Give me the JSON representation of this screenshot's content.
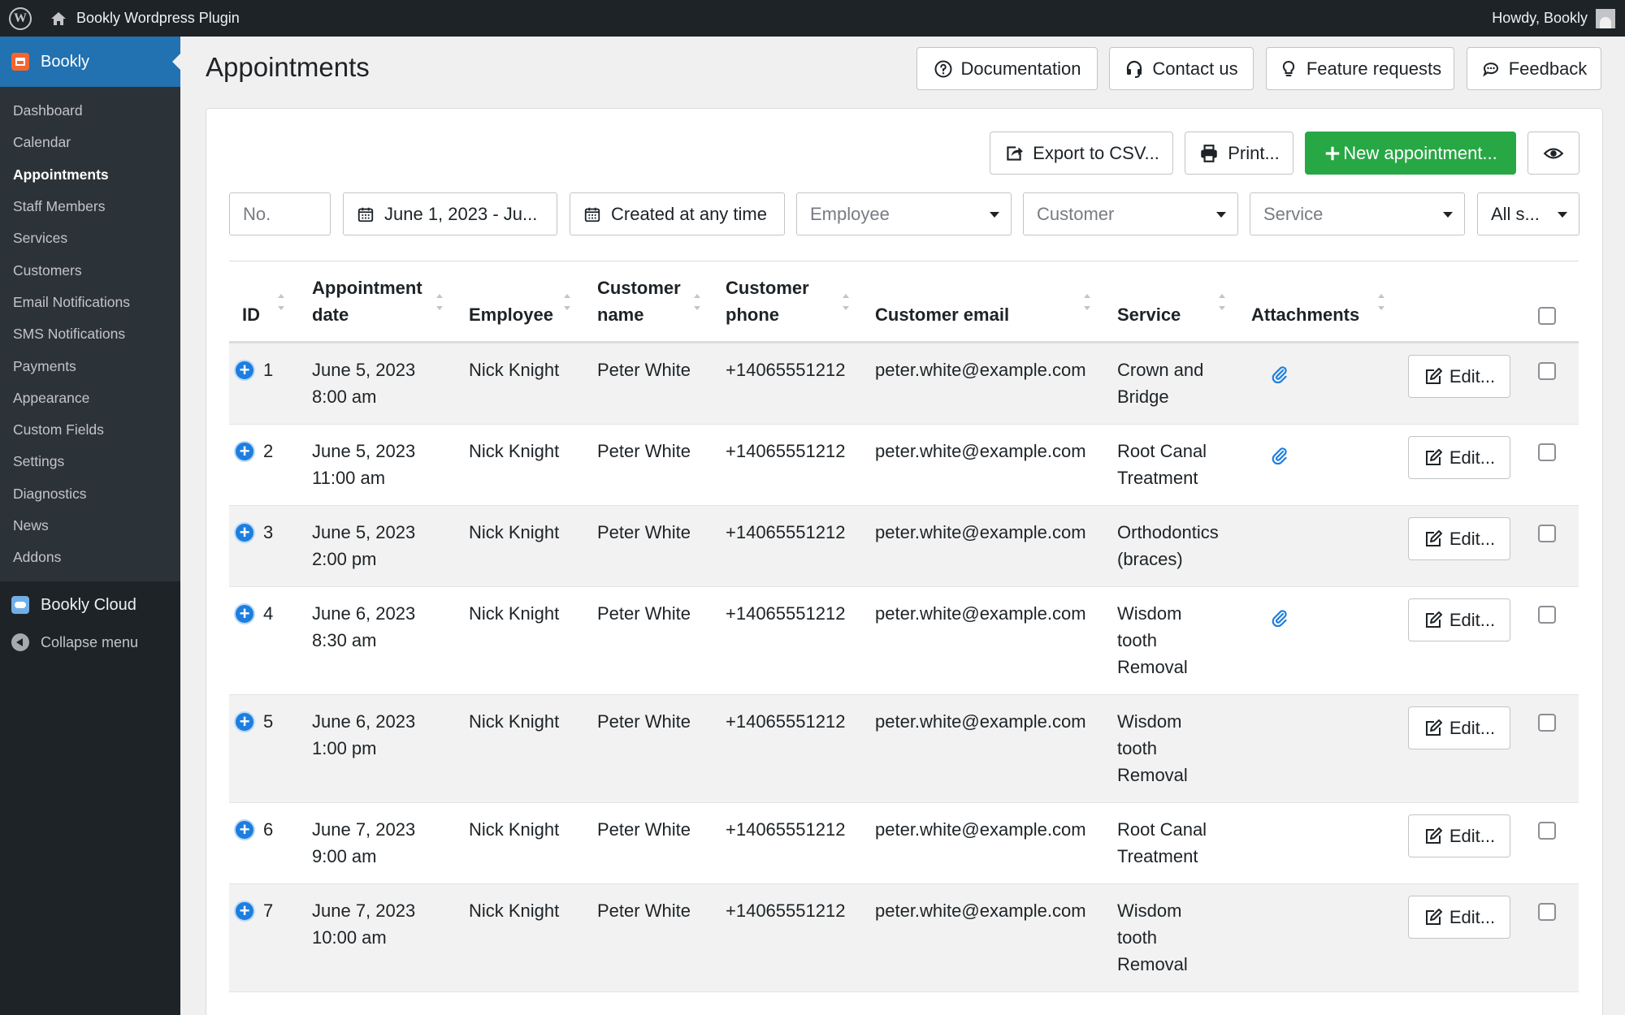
{
  "admin_bar": {
    "site_name": "Bookly Wordpress Plugin",
    "greeting": "Howdy, Bookly"
  },
  "sidebar": {
    "plugin": "Bookly",
    "items": [
      {
        "label": "Dashboard"
      },
      {
        "label": "Calendar"
      },
      {
        "label": "Appointments",
        "active": true
      },
      {
        "label": "Staff Members"
      },
      {
        "label": "Services"
      },
      {
        "label": "Customers"
      },
      {
        "label": "Email Notifications"
      },
      {
        "label": "SMS Notifications"
      },
      {
        "label": "Payments"
      },
      {
        "label": "Appearance"
      },
      {
        "label": "Custom Fields"
      },
      {
        "label": "Settings"
      },
      {
        "label": "Diagnostics"
      },
      {
        "label": "News"
      },
      {
        "label": "Addons"
      }
    ],
    "cloud": "Bookly Cloud",
    "collapse": "Collapse menu"
  },
  "page": {
    "title": "Appointments",
    "header_buttons": {
      "documentation": "Documentation",
      "contact": "Contact us",
      "feature_requests": "Feature requests",
      "feedback": "Feedback"
    }
  },
  "toolbar": {
    "export": "Export to CSV...",
    "print": "Print...",
    "new_appointment": "New appointment..."
  },
  "filters": {
    "number_placeholder": "No.",
    "date_range": "June 1, 2023 - Ju...",
    "created": "Created at any time",
    "employee": "Employee",
    "customer": "Customer",
    "service": "Service",
    "status": "All s..."
  },
  "table": {
    "columns": {
      "id": "ID",
      "date_1": "Appointment",
      "date_2": "date",
      "employee": "Employee",
      "name_1": "Customer",
      "name_2": "name",
      "phone_1": "Customer",
      "phone_2": "phone",
      "email": "Customer email",
      "service": "Service",
      "attachments": "Attachments"
    },
    "edit_label": "Edit...",
    "rows": [
      {
        "id": "1",
        "date": "June 5, 2023",
        "time": "8:00 am",
        "employee": "Nick Knight",
        "customer": "Peter White",
        "phone": "+14065551212",
        "email": "peter.white@example.com",
        "service": [
          "Crown and",
          "Bridge"
        ],
        "attachment": true
      },
      {
        "id": "2",
        "date": "June 5, 2023",
        "time": "11:00 am",
        "employee": "Nick Knight",
        "customer": "Peter White",
        "phone": "+14065551212",
        "email": "peter.white@example.com",
        "service": [
          "Root Canal",
          "Treatment"
        ],
        "attachment": true
      },
      {
        "id": "3",
        "date": "June 5, 2023",
        "time": "2:00 pm",
        "employee": "Nick Knight",
        "customer": "Peter White",
        "phone": "+14065551212",
        "email": "peter.white@example.com",
        "service": [
          "Orthodontics",
          "(braces)"
        ],
        "attachment": false
      },
      {
        "id": "4",
        "date": "June 6, 2023",
        "time": "8:30 am",
        "employee": "Nick Knight",
        "customer": "Peter White",
        "phone": "+14065551212",
        "email": "peter.white@example.com",
        "service": [
          "Wisdom",
          "tooth",
          "Removal"
        ],
        "attachment": true
      },
      {
        "id": "5",
        "date": "June 6, 2023",
        "time": "1:00 pm",
        "employee": "Nick Knight",
        "customer": "Peter White",
        "phone": "+14065551212",
        "email": "peter.white@example.com",
        "service": [
          "Wisdom",
          "tooth",
          "Removal"
        ],
        "attachment": false
      },
      {
        "id": "6",
        "date": "June 7, 2023",
        "time": "9:00 am",
        "employee": "Nick Knight",
        "customer": "Peter White",
        "phone": "+14065551212",
        "email": "peter.white@example.com",
        "service": [
          "Root Canal",
          "Treatment"
        ],
        "attachment": false
      },
      {
        "id": "7",
        "date": "June 7, 2023",
        "time": "10:00 am",
        "employee": "Nick Knight",
        "customer": "Peter White",
        "phone": "+14065551212",
        "email": "peter.white@example.com",
        "service": [
          "Wisdom",
          "tooth",
          "Removal"
        ],
        "attachment": false
      }
    ]
  },
  "colors": {
    "accent": "#2271b1",
    "green": "#28a745",
    "admin_dark": "#1d2327",
    "bookly_orange": "#f4662f",
    "plus_blue": "#1d7ee0"
  }
}
